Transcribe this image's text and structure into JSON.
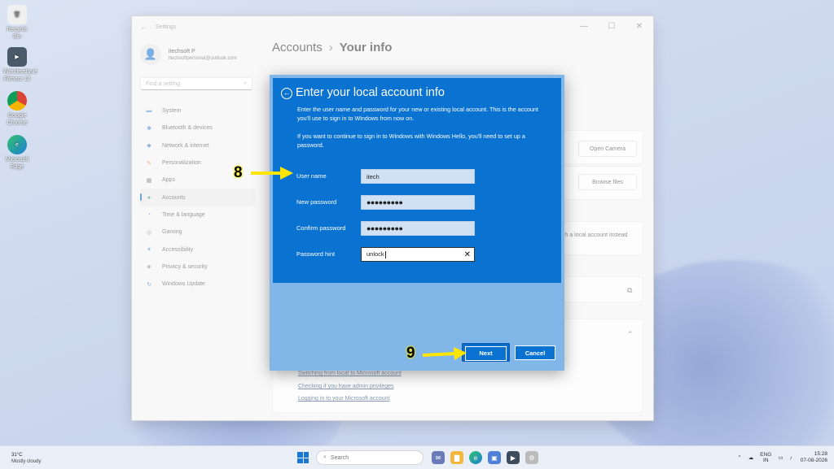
{
  "desktop": {
    "icons": [
      {
        "label": "Recycle Bin",
        "glyph": "🗑",
        "bg": "#f0f0f0"
      },
      {
        "label": "Wondershare Filmora 12",
        "glyph": "▶",
        "bg": "#4a5a6a"
      },
      {
        "label": "Google Chrome",
        "glyph": "◉",
        "bg": "#e9e9e9"
      },
      {
        "label": "Microsoft Edge",
        "glyph": "e",
        "bg": "#2f8fd6"
      }
    ]
  },
  "settings": {
    "app_title": "Settings",
    "user_name": "itechsoft P",
    "user_email": "itechsoftpersonal@outlook.com",
    "find_placeholder": "Find a setting",
    "nav": [
      {
        "label": "System",
        "icon": "▬"
      },
      {
        "label": "Bluetooth & devices",
        "icon": "✱"
      },
      {
        "label": "Network & internet",
        "icon": "◆"
      },
      {
        "label": "Personalization",
        "icon": "✎"
      },
      {
        "label": "Apps",
        "icon": "▦"
      },
      {
        "label": "Accounts",
        "icon": "●"
      },
      {
        "label": "Time & language",
        "icon": "◔"
      },
      {
        "label": "Gaming",
        "icon": "◎"
      },
      {
        "label": "Accessibility",
        "icon": "✶"
      },
      {
        "label": "Privacy & security",
        "icon": "◈"
      },
      {
        "label": "Windows Update",
        "icon": "↻"
      }
    ],
    "breadcrumb_parent": "Accounts",
    "breadcrumb_sep": "›",
    "breadcrumb_current": "Your info",
    "open_camera": "Open Camera",
    "browse_files": "Browse files",
    "local_account_text": "ith a local account instead",
    "related": [
      "Switching from local to Microsoft account",
      "Checking if you have admin privileges",
      "Logging in to your Microsoft account"
    ]
  },
  "dialog": {
    "title": "Enter your local account info",
    "para1": "Enter the user name and password for your new or existing local account. This is the account you'll use to sign in to Windows from now on.",
    "para2": "If you want to continue to sign in to Windows with Windows Hello, you'll need to set up a password.",
    "fields": [
      {
        "label": "User name",
        "value": "itech"
      },
      {
        "label": "New password",
        "value": "●●●●●●●●●"
      },
      {
        "label": "Confirm password",
        "value": "●●●●●●●●●"
      },
      {
        "label": "Password hint",
        "value": "unlock"
      }
    ],
    "next_label": "Next",
    "cancel_label": "Cancel"
  },
  "annotations": {
    "step8": "8",
    "step9": "9",
    "color": "#ffe600"
  },
  "taskbar": {
    "temp": "31°C",
    "condition": "Mostly cloudy",
    "search_placeholder": "Search",
    "lang_top": "ENG",
    "lang_bottom": "IN",
    "time": "15:28",
    "date": "07-08-2026"
  }
}
